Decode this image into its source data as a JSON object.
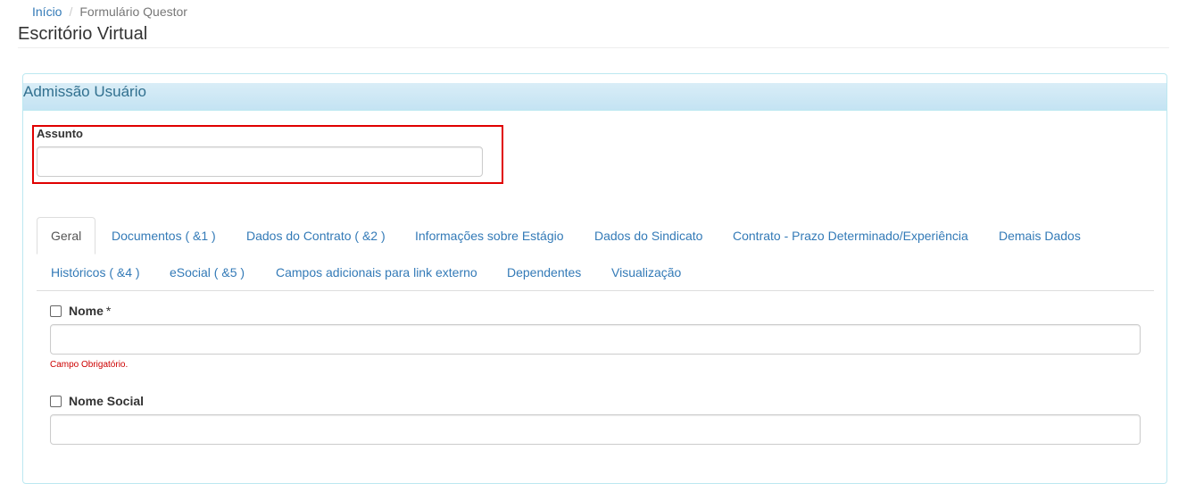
{
  "breadcrumb": {
    "home": "Início",
    "separator": "/",
    "current": "Formulário Questor"
  },
  "page": {
    "title": "Escritório Virtual"
  },
  "panel": {
    "title": "Admissão Usuário"
  },
  "assunto": {
    "label": "Assunto",
    "value": "",
    "placeholder": ""
  },
  "tabs": [
    {
      "label": "Geral",
      "active": true
    },
    {
      "label": "Documentos ( &1 )"
    },
    {
      "label": "Dados do Contrato ( &2 )"
    },
    {
      "label": "Informações sobre Estágio"
    },
    {
      "label": "Dados do Sindicato"
    },
    {
      "label": "Contrato - Prazo Determinado/Experiência"
    },
    {
      "label": "Demais Dados"
    },
    {
      "label": "Históricos ( &4 )"
    },
    {
      "label": "eSocial ( &5 )"
    },
    {
      "label": "Campos adicionais para link externo"
    },
    {
      "label": "Dependentes"
    },
    {
      "label": "Visualização"
    }
  ],
  "fields": {
    "nome": {
      "label": "Nome",
      "required_mark": "*",
      "value": "",
      "error": "Campo Obrigatório.",
      "checked": false
    },
    "nome_social": {
      "label": "Nome Social",
      "value": "",
      "checked": false
    }
  },
  "colors": {
    "link": "#337ab7",
    "panel_heading": "#d9edf7",
    "panel_title": "#31708f",
    "highlight_border": "#e00000",
    "error": "#cc0000"
  }
}
